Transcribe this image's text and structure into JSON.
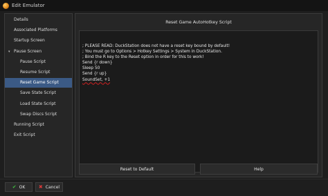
{
  "window": {
    "title": "Edit Emulator"
  },
  "sidebar": {
    "items": [
      {
        "label": "Details",
        "level": 0,
        "selected": false,
        "expandable": false
      },
      {
        "label": "Associated Platforms",
        "level": 0,
        "selected": false,
        "expandable": false
      },
      {
        "label": "Startup Screen",
        "level": 0,
        "selected": false,
        "expandable": false
      },
      {
        "label": "Pause Screen",
        "level": 0,
        "selected": false,
        "expandable": true
      },
      {
        "label": "Pause Script",
        "level": 1,
        "selected": false,
        "expandable": false
      },
      {
        "label": "Resume Script",
        "level": 1,
        "selected": false,
        "expandable": false
      },
      {
        "label": "Reset Game Script",
        "level": 1,
        "selected": true,
        "expandable": false
      },
      {
        "label": "Save State Script",
        "level": 1,
        "selected": false,
        "expandable": false
      },
      {
        "label": "Load State Script",
        "level": 1,
        "selected": false,
        "expandable": false
      },
      {
        "label": "Swap Discs Script",
        "level": 1,
        "selected": false,
        "expandable": false
      },
      {
        "label": "Running Script",
        "level": 0,
        "selected": false,
        "expandable": false
      },
      {
        "label": "Exit Script",
        "level": 0,
        "selected": false,
        "expandable": false
      }
    ],
    "expand_glyph": "▾"
  },
  "panel": {
    "header": "Reset Game AutoHotkey Script",
    "script_lines": [
      {
        "text": "; PLEASE READ: DuckStation does not have a reset key bound by default!",
        "error": false
      },
      {
        "text": "; You must go to Options > Hotkey Settings > System in DuckStation.",
        "error": false
      },
      {
        "text": "; Bind the R key to the Reset option in order for this to work!",
        "error": false
      },
      {
        "text": "Send {r down}",
        "error": false
      },
      {
        "text": "Sleep 50",
        "error": false
      },
      {
        "text": "Send {r up}",
        "error": false
      },
      {
        "text": "SoundSet, +1",
        "error": true
      }
    ],
    "reset_label": "Reset to Default",
    "help_label": "Help"
  },
  "footer": {
    "ok_label": "OK",
    "cancel_label": "Cancel",
    "ok_icon": "✔",
    "cancel_icon": "✖"
  }
}
